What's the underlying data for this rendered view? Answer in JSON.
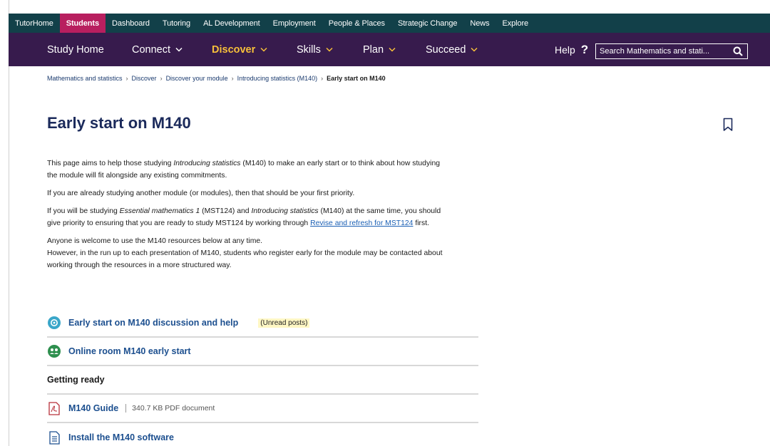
{
  "global_nav": [
    {
      "label": "TutorHome",
      "active": false
    },
    {
      "label": "Students",
      "active": true
    },
    {
      "label": "Dashboard",
      "active": false
    },
    {
      "label": "Tutoring",
      "active": false
    },
    {
      "label": "AL Development",
      "active": false
    },
    {
      "label": "Employment",
      "active": false
    },
    {
      "label": "People & Places",
      "active": false
    },
    {
      "label": "Strategic Change",
      "active": false
    },
    {
      "label": "News",
      "active": false
    },
    {
      "label": "Explore",
      "active": false
    }
  ],
  "site_nav": {
    "study_home": "Study Home",
    "connect": "Connect",
    "discover": "Discover",
    "skills": "Skills",
    "plan": "Plan",
    "succeed": "Succeed",
    "help": "Help",
    "help_mark": "?",
    "search_placeholder": "Search Mathematics and stati..."
  },
  "breadcrumb": {
    "items": [
      "Mathematics and statistics",
      "Discover",
      "Discover your module",
      "Introducing statistics (M140)"
    ],
    "current": "Early start on M140",
    "separator": "›"
  },
  "page": {
    "title": "Early start on M140",
    "p1_a": "This page aims to help those studying ",
    "p1_em": "Introducing statistics",
    "p1_b": " (M140) to make an early start or to think about how studying the module will fit alongside any existing commitments.",
    "p2": "If you are already studying another module (or modules), then that should be your first priority.",
    "p3_a": "If you will be studying ",
    "p3_em1": "Essential mathematics 1",
    "p3_b": " (MST124) and ",
    "p3_em2": "Introducing statistics",
    "p3_c": " (M140) at the same time, you should give priority to ensuring that you are ready to study MST124 by working through ",
    "p3_link": "Revise and refresh for MST124",
    "p3_d": " first.",
    "p4_line1": "Anyone is welcome to use the M140 resources below at any time.",
    "p4_line2": "However, in the run up to each presentation of M140, students who register early for the module may be contacted about working through the resources in a more structured way."
  },
  "resources": {
    "forum_label": "Early start on M140 discussion and help",
    "forum_badge": "(Unread posts)",
    "room_label": "Online room M140 early start",
    "section_heading": "Getting ready",
    "guide_label": "M140 Guide",
    "guide_meta": "340.7 KB PDF document",
    "software_label": "Install the M140 software"
  },
  "colors": {
    "global_nav_bg": "#124049",
    "active_tab": "#b81f5f",
    "site_nav_bg": "#371b4d",
    "discover_accent": "#f7c03a",
    "title": "#1b2a5b",
    "link": "#1c4f8f"
  }
}
